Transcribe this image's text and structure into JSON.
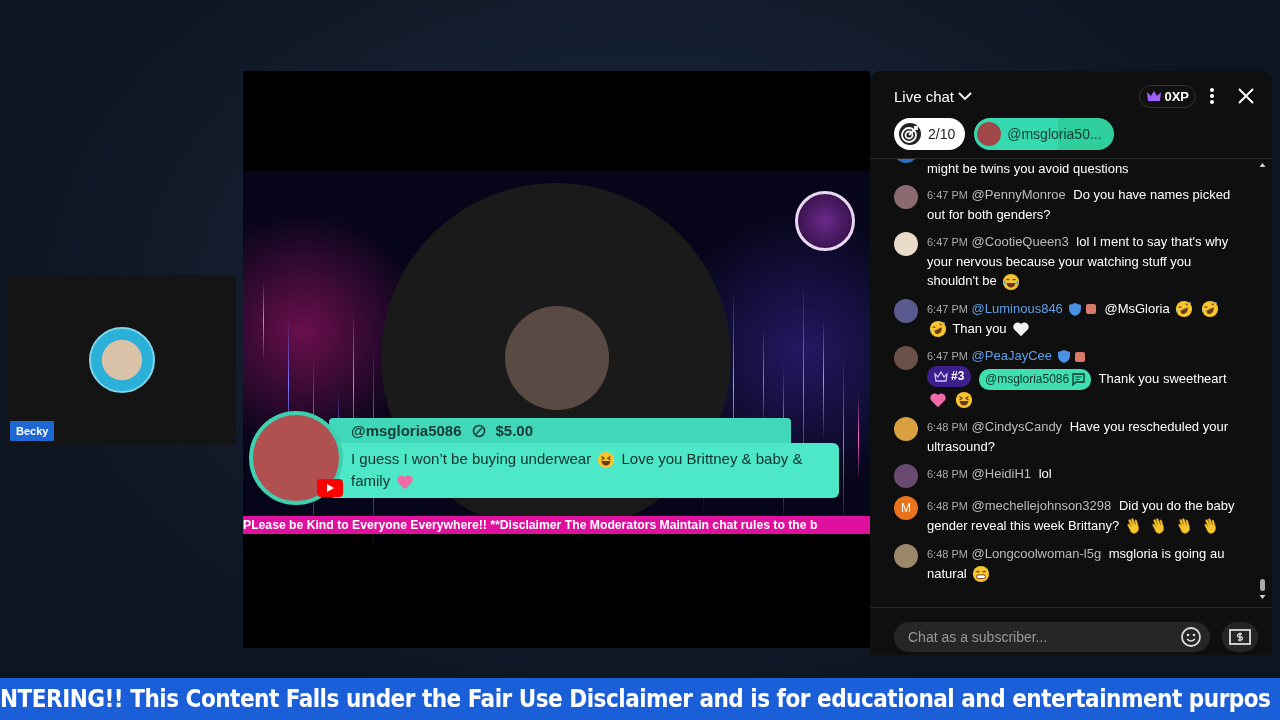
{
  "guest_tile": {
    "name": "Becky"
  },
  "stage": {
    "highlight": {
      "author": "@msgloria5086",
      "amount": "$5.00",
      "parts": [
        {
          "kind": "text",
          "text": "I guess I won’t be buying underwear"
        },
        {
          "kind": "laughing"
        },
        {
          "kind": "text",
          "text": "Love you Brittney & baby & family"
        },
        {
          "kind": "pink-heart"
        }
      ]
    },
    "ticker": "PLease be Kind to Everyone Everywhere!! **Disclaimer The Moderators Maintain chat rules to the b"
  },
  "chat": {
    "title": "Live chat",
    "xp": "0XP",
    "goal": "2/10",
    "pinned_chip": "@msgloria50...",
    "messages": [
      {
        "kind": "continued",
        "color": "#2a6fc0",
        "parts": [
          {
            "kind": "text",
            "text": "might be twins you avoid questions"
          }
        ]
      },
      {
        "kind": "message",
        "color": "#8a6a70",
        "time": "6:47 PM",
        "author": "@PennyMonroe",
        "moderator": false,
        "parts": [
          {
            "kind": "text",
            "text": "Do you have names picked out for both genders?"
          }
        ]
      },
      {
        "kind": "message",
        "color": "#e8dcc8",
        "time": "6:47 PM",
        "author": "@CootieQueen3",
        "moderator": false,
        "parts": [
          {
            "kind": "text",
            "text": "lol I ment to say that's why your nervous because your watching stuff you shouldn't be"
          },
          {
            "kind": "tears-of-joy"
          }
        ]
      },
      {
        "kind": "message",
        "color": "#5a5a90",
        "time": "6:47 PM",
        "author": "@Luminous846",
        "moderator": true,
        "parts": [
          {
            "kind": "text",
            "text": "@MsGloria"
          },
          {
            "kind": "rolling-laughing"
          },
          {
            "kind": "rolling-laughing"
          },
          {
            "kind": "rolling-laughing"
          },
          {
            "kind": "text",
            "text": "Than you"
          },
          {
            "kind": "white-heart"
          }
        ]
      },
      {
        "kind": "message",
        "color": "#6a5048",
        "time": "6:47 PM",
        "author": "@PeaJayCee",
        "moderator": true,
        "rank": "#3",
        "mention": "@msgloria5086",
        "parts": [
          {
            "kind": "text",
            "text": "Thank you sweetheart"
          },
          {
            "kind": "pink-heart"
          },
          {
            "kind": "grin-squint"
          }
        ]
      },
      {
        "kind": "message",
        "color": "#d8a040",
        "time": "6:48 PM",
        "author": "@CindysCandy",
        "moderator": false,
        "parts": [
          {
            "kind": "text",
            "text": "Have you rescheduled your ultrasound?"
          }
        ]
      },
      {
        "kind": "message",
        "color": "#6a4a70",
        "time": "6:48 PM",
        "author": "@HeidiH1",
        "moderator": false,
        "parts": [
          {
            "kind": "text",
            "text": "lol"
          }
        ]
      },
      {
        "kind": "message",
        "color": "#e8731c",
        "letter": "M",
        "time": "6:48 PM",
        "author": "@mechellejohnson3298",
        "moderator": false,
        "parts": [
          {
            "kind": "text",
            "text": "Did you do the baby gender reveal this week Brittany?"
          },
          {
            "kind": "waving-hand"
          },
          {
            "kind": "waving-hand"
          },
          {
            "kind": "waving-hand"
          },
          {
            "kind": "waving-hand"
          }
        ]
      },
      {
        "kind": "message",
        "color": "#9a8868",
        "time": "6:48 PM",
        "author": "@Longcoolwoman-l5g",
        "moderator": false,
        "parts": [
          {
            "kind": "text",
            "text": "msgloria is going au natural"
          },
          {
            "kind": "grin"
          }
        ]
      }
    ],
    "input": {
      "placeholder": "Chat as a subscriber..."
    }
  },
  "bottom_ticker": "NTERING!! This Content Falls under the Fair Use Disclaimer and is for educational and entertainment purpos"
}
